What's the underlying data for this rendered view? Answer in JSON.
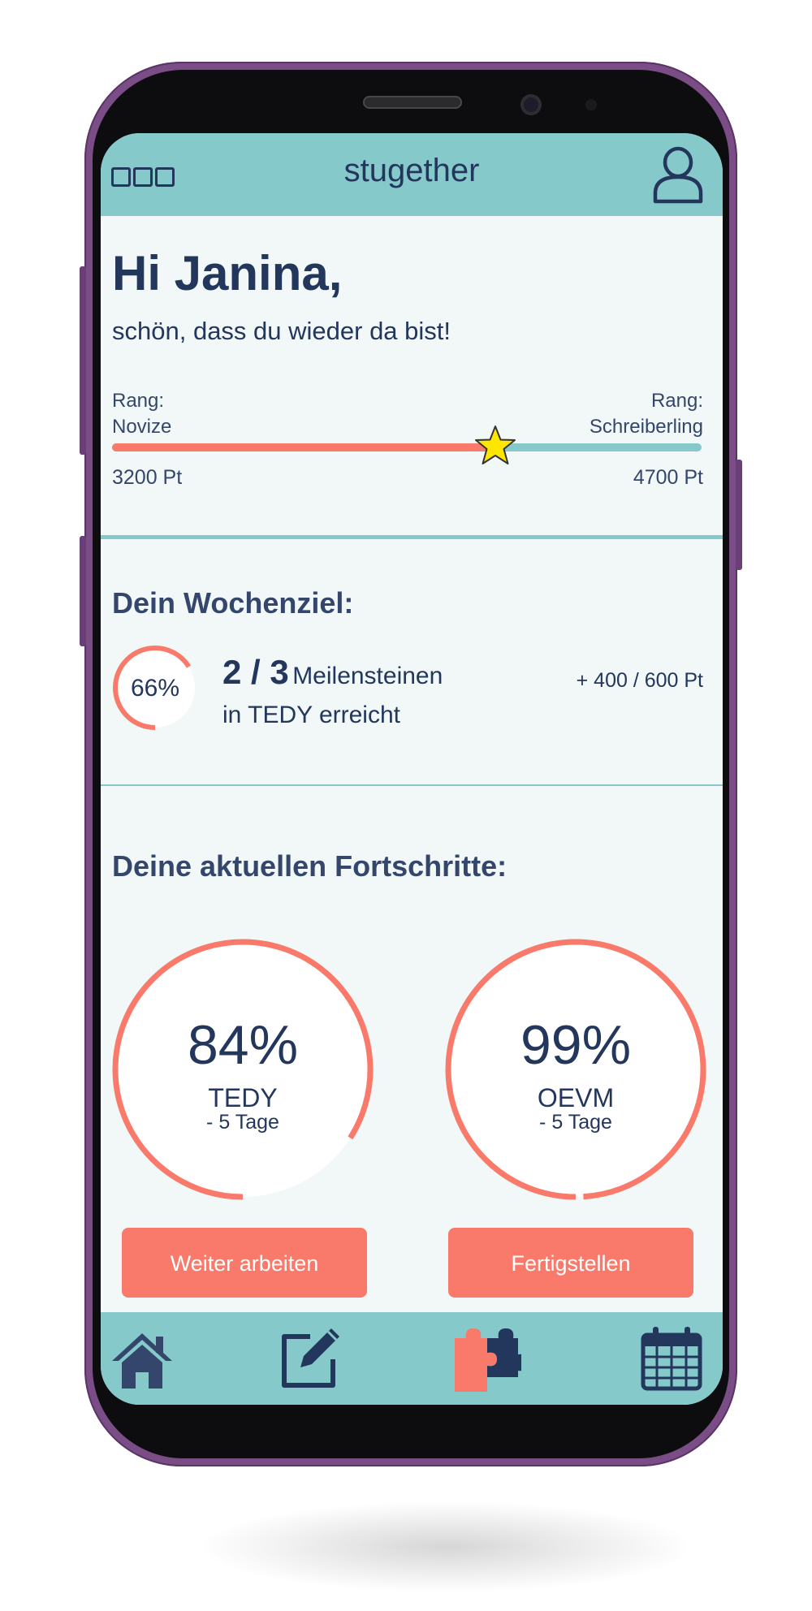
{
  "header": {
    "title": "stugether",
    "menu_icon": "three-squares-menu-icon",
    "profile_icon": "user-profile-icon"
  },
  "greeting": {
    "title": "Hi Janina,",
    "subtitle": "schön, dass du wieder da bist!"
  },
  "rank": {
    "current_label": "Rang:",
    "current_name": "Novize",
    "next_label": "Rang:",
    "next_name": "Schreiberling",
    "current_points": "3200 Pt",
    "next_points": "4700 Pt",
    "progress": 0.65,
    "marker_icon": "star-icon"
  },
  "weekly_goal": {
    "title": "Dein Wochenziel:",
    "percent_text": "66%",
    "percent": 0.66,
    "count": "2 / 3",
    "unit": "Meilensteinen",
    "detail": "in TEDY erreicht",
    "points": "+ 400 / 600 Pt"
  },
  "progress_section": {
    "title": "Deine aktuellen Fortschritte:",
    "items": [
      {
        "percent_text": "84%",
        "percent": 0.84,
        "name": "TEDY",
        "days": "- 5 Tage",
        "button": "Weiter arbeiten"
      },
      {
        "percent_text": "99%",
        "percent": 0.99,
        "name": "OEVM",
        "days": "- 5 Tage",
        "button": "Fertigstellen"
      }
    ]
  },
  "bottom_nav": [
    {
      "icon": "home-icon"
    },
    {
      "icon": "edit-icon"
    },
    {
      "icon": "puzzle-icon"
    },
    {
      "icon": "calendar-icon"
    }
  ],
  "colors": {
    "primary_teal": "#86c9ca",
    "accent_coral": "#f97a6a",
    "navy": "#23365c",
    "background": "#f1f8f7"
  }
}
